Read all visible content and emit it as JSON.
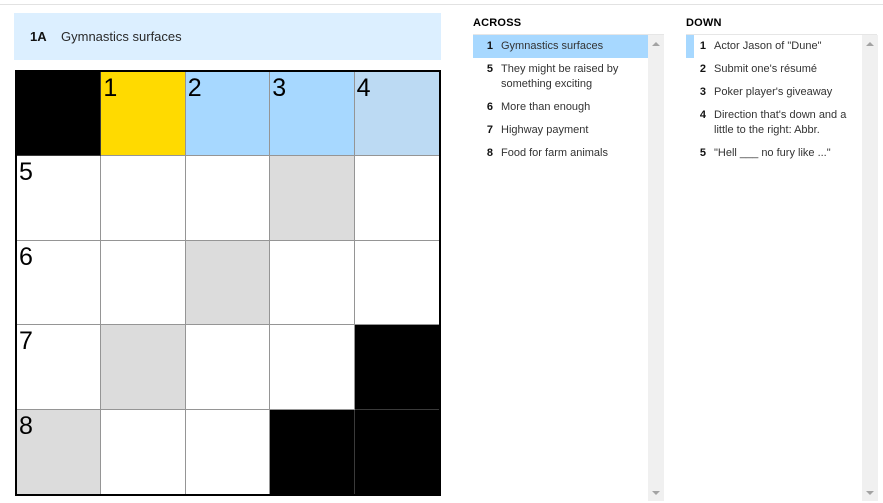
{
  "clue_bar": {
    "label": "1A",
    "text": "Gymnastics surfaces"
  },
  "grid": {
    "rows": 5,
    "cols": 5,
    "cells": [
      {
        "state": "black",
        "number": ""
      },
      {
        "state": "selected",
        "number": "1"
      },
      {
        "state": "word",
        "number": "2"
      },
      {
        "state": "word",
        "number": "3"
      },
      {
        "state": "word-alt",
        "number": "4"
      },
      {
        "state": "open",
        "number": "5"
      },
      {
        "state": "open",
        "number": ""
      },
      {
        "state": "open",
        "number": ""
      },
      {
        "state": "gray",
        "number": ""
      },
      {
        "state": "open",
        "number": ""
      },
      {
        "state": "open",
        "number": "6"
      },
      {
        "state": "open",
        "number": ""
      },
      {
        "state": "gray",
        "number": ""
      },
      {
        "state": "open",
        "number": ""
      },
      {
        "state": "open",
        "number": ""
      },
      {
        "state": "open",
        "number": "7"
      },
      {
        "state": "gray",
        "number": ""
      },
      {
        "state": "open",
        "number": ""
      },
      {
        "state": "open",
        "number": ""
      },
      {
        "state": "black",
        "number": ""
      },
      {
        "state": "gray",
        "number": "8"
      },
      {
        "state": "open",
        "number": ""
      },
      {
        "state": "open",
        "number": ""
      },
      {
        "state": "black",
        "number": ""
      },
      {
        "state": "black",
        "number": ""
      }
    ]
  },
  "across": {
    "title": "ACROSS",
    "clues": [
      {
        "num": "1",
        "text": "Gymnastics surfaces",
        "state": "active"
      },
      {
        "num": "5",
        "text": "They might be raised by something exciting",
        "state": ""
      },
      {
        "num": "6",
        "text": "More than enough",
        "state": ""
      },
      {
        "num": "7",
        "text": "Highway payment",
        "state": ""
      },
      {
        "num": "8",
        "text": "Food for farm animals",
        "state": ""
      }
    ]
  },
  "down": {
    "title": "DOWN",
    "clues": [
      {
        "num": "1",
        "text": "Actor Jason of \"Dune\"",
        "state": "related"
      },
      {
        "num": "2",
        "text": "Submit one's résumé",
        "state": ""
      },
      {
        "num": "3",
        "text": "Poker player's giveaway",
        "state": ""
      },
      {
        "num": "4",
        "text": "Direction that's down and a little to the right: Abbr.",
        "state": ""
      },
      {
        "num": "5",
        "text": "\"Hell ___ no fury like ...\"",
        "state": ""
      }
    ]
  },
  "colors": {
    "selected_cell": "#ffda00",
    "word_highlight": "#a7d8ff",
    "clue_bar_bg": "#dcefff",
    "penciled_gray": "#dcdcdc"
  }
}
